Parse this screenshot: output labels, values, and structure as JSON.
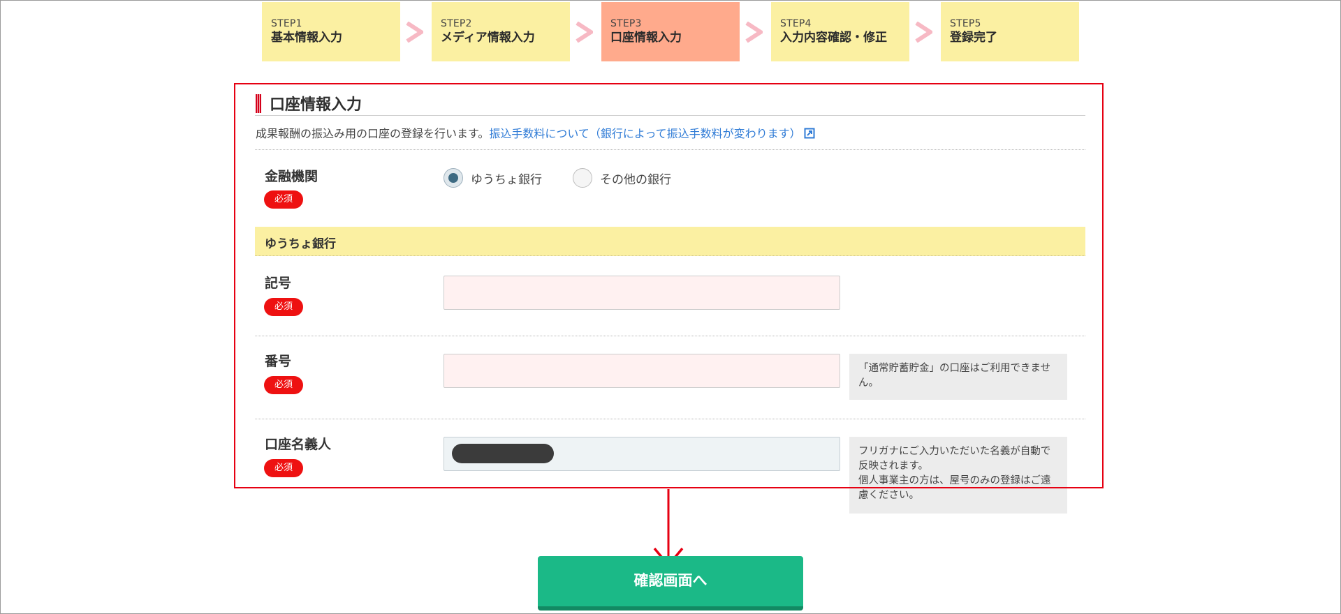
{
  "steps": [
    {
      "num": "STEP1",
      "name": "基本情報入力"
    },
    {
      "num": "STEP2",
      "name": "メディア情報入力"
    },
    {
      "num": "STEP3",
      "name": "口座情報入力"
    },
    {
      "num": "STEP4",
      "name": "入力内容確認・修正"
    },
    {
      "num": "STEP5",
      "name": "登録完了"
    }
  ],
  "colors": {
    "step_bg": "#fbf0a2",
    "step_active_bg": "#ffaa8c",
    "chevron": "#f7b9c4",
    "required_badge": "#ee1111",
    "highlight": "#e60012",
    "button": "#1bb987",
    "link": "#2f7bd6"
  },
  "section": {
    "title": "口座情報入力",
    "description": "成果報酬の振込み用の口座の登録を行います。",
    "fee_link": "振込手数料について（銀行によって振込手数料が変わります）",
    "fee_link_icon": "external-link-icon"
  },
  "required_label": "必須",
  "bank": {
    "label": "金融機関",
    "options": [
      {
        "label": "ゆうちょ銀行",
        "selected": true
      },
      {
        "label": "その他の銀行",
        "selected": false
      }
    ]
  },
  "subheading": "ゆうちょ銀行",
  "fields": {
    "symbol": {
      "label": "記号",
      "value": ""
    },
    "number": {
      "label": "番号",
      "value": "",
      "note": "「通常貯蓄貯金」の口座はご利用できません。"
    },
    "holder": {
      "label": "口座名義人",
      "value": "(redacted)",
      "note": "フリガナにご入力いただいた名義が自動で反映されます。\n個人事業主の方は、屋号のみの登録はご遠慮ください。"
    }
  },
  "confirm_button": "確認画面へ"
}
